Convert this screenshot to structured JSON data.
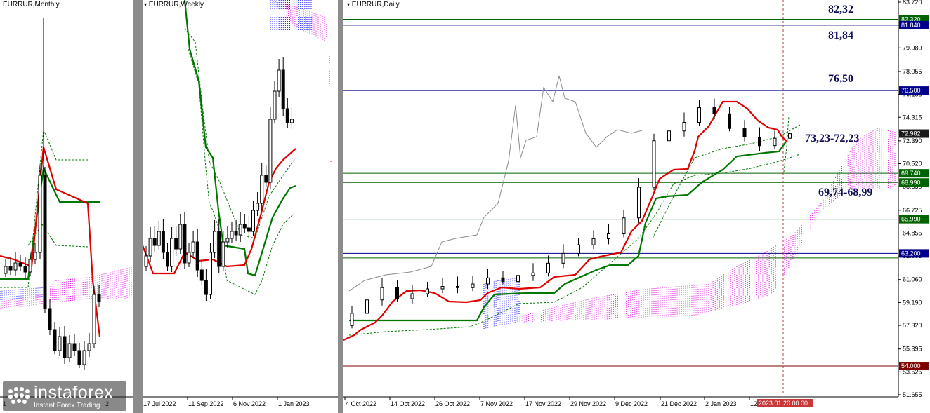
{
  "monthly": {
    "title": "EURRUR,Monthly",
    "xticks": [
      "1",
      "2"
    ]
  },
  "weekly": {
    "title": "EURRUR,Weekly",
    "xticks": [
      "17 Jul 2022",
      "11 Sep 2022",
      "6 Nov 2022",
      "1 Jan 2023"
    ]
  },
  "daily": {
    "title": "EURRUR,Daily",
    "xticks": [
      "4 Oct 2022",
      "14 Oct 2022",
      "26 Oct 2022",
      "7 Nov 2022",
      "17 Nov 2022",
      "29 Nov 2022",
      "9 Dec 2022",
      "21 Dec 2022",
      "2 Jan 2023",
      "12"
    ],
    "cursor_time": "2023.01.20 00:00"
  },
  "watermark": {
    "brand": "instaforex",
    "tagline": "Instant Forex Trading"
  },
  "colors": {
    "tenkan": "#e00000",
    "kijun": "#007700",
    "cloud_bull": "#1a1aff",
    "cloud_bear": "#e000e0",
    "level_blue": "#00008b",
    "level_green": "#006400",
    "candle": "#000000",
    "chikou": "#8a8a95",
    "price_tag": "#1a1a1a",
    "cursor_tag": "#c83838"
  },
  "chart_data": [
    {
      "type": "candlestick",
      "title": "EURRUR,Monthly",
      "note": "overview panel, no price axis shown"
    },
    {
      "type": "candlestick",
      "title": "EURRUR,Weekly",
      "x": [
        "17 Jul 2022",
        "11 Sep 2022",
        "6 Nov 2022",
        "1 Jan 2023"
      ]
    },
    {
      "type": "candlestick",
      "title": "EURRUR,Daily",
      "ylim": [
        51.655,
        83.72
      ],
      "yticks": [
        83.72,
        81.84,
        79.98,
        78.055,
        76.185,
        74.315,
        72.39,
        70.52,
        68.65,
        66.725,
        64.855,
        62.985,
        61.06,
        59.19,
        57.32,
        55.395,
        53.525,
        51.655
      ],
      "x": [
        "4 Oct 2022",
        "14 Oct 2022",
        "26 Oct 2022",
        "7 Nov 2022",
        "17 Nov 2022",
        "29 Nov 2022",
        "9 Dec 2022",
        "21 Dec 2022",
        "2 Jan 2023",
        "12"
      ],
      "current_price": 72.982,
      "levels": [
        {
          "value": 82.32,
          "tag": "82.320",
          "color": "green"
        },
        {
          "value": 81.84,
          "tag": "81.840",
          "color": "blue"
        },
        {
          "value": 76.5,
          "tag": "76.500",
          "color": "blue"
        },
        {
          "value": 69.74,
          "tag": "69.740",
          "color": "green"
        },
        {
          "value": 68.99,
          "tag": "68.990",
          "color": "green"
        },
        {
          "value": 65.99,
          "tag": "65.990",
          "color": "green"
        },
        {
          "value": 63.2,
          "tag": "63.200",
          "color": "blue"
        },
        {
          "value": 62.83,
          "tag": "",
          "color": "green"
        },
        {
          "value": 54.0,
          "tag": "54.000",
          "color": "darkred"
        }
      ],
      "annotations": [
        "82,32",
        "81,84",
        "76,50",
        "73,23-72,23",
        "69,74-68,99"
      ],
      "series": [
        {
          "name": "",
          "role": "candles",
          "values": [
            58.3,
            59.4,
            60.4,
            59.5,
            59.9,
            60.3,
            60.5,
            60.4,
            60.7,
            61.2,
            60.9,
            61.4,
            61.6,
            62.4,
            63.2,
            63.9,
            64.4,
            64.8,
            66.1,
            68.6,
            72.4,
            73.2,
            73.9,
            75.1,
            74.6,
            73.4,
            72.7,
            72.0,
            72.6,
            72.98
          ]
        },
        {
          "name": "",
          "role": "tenkan",
          "values": [
            55.9,
            57.3,
            59.6,
            60.1,
            60.3,
            60.2,
            60.4,
            60.7,
            60.9,
            61.2,
            61.6,
            62.6,
            63.9,
            64.7,
            66.2,
            68.7,
            70.1,
            71.8,
            72.8,
            74.7,
            74.4,
            73.0,
            72.23
          ]
        },
        {
          "name": "",
          "role": "kijun",
          "values": [
            57.7,
            57.7,
            58.7,
            59.8,
            60.2,
            60.4,
            61.1,
            62.1,
            63.2,
            66.5,
            67.4,
            68.7,
            69.6,
            70.2,
            70.9,
            71.8
          ]
        },
        {
          "name": "",
          "role": "chikou",
          "values": [
            62.2,
            62.5,
            62.9,
            62.2,
            63.1,
            64.3,
            65.0,
            66.7,
            68.2,
            73.9,
            71.3,
            75.7,
            75.2,
            76.6,
            75.3,
            73.1,
            71.9,
            72.8,
            72.5
          ]
        }
      ]
    }
  ]
}
